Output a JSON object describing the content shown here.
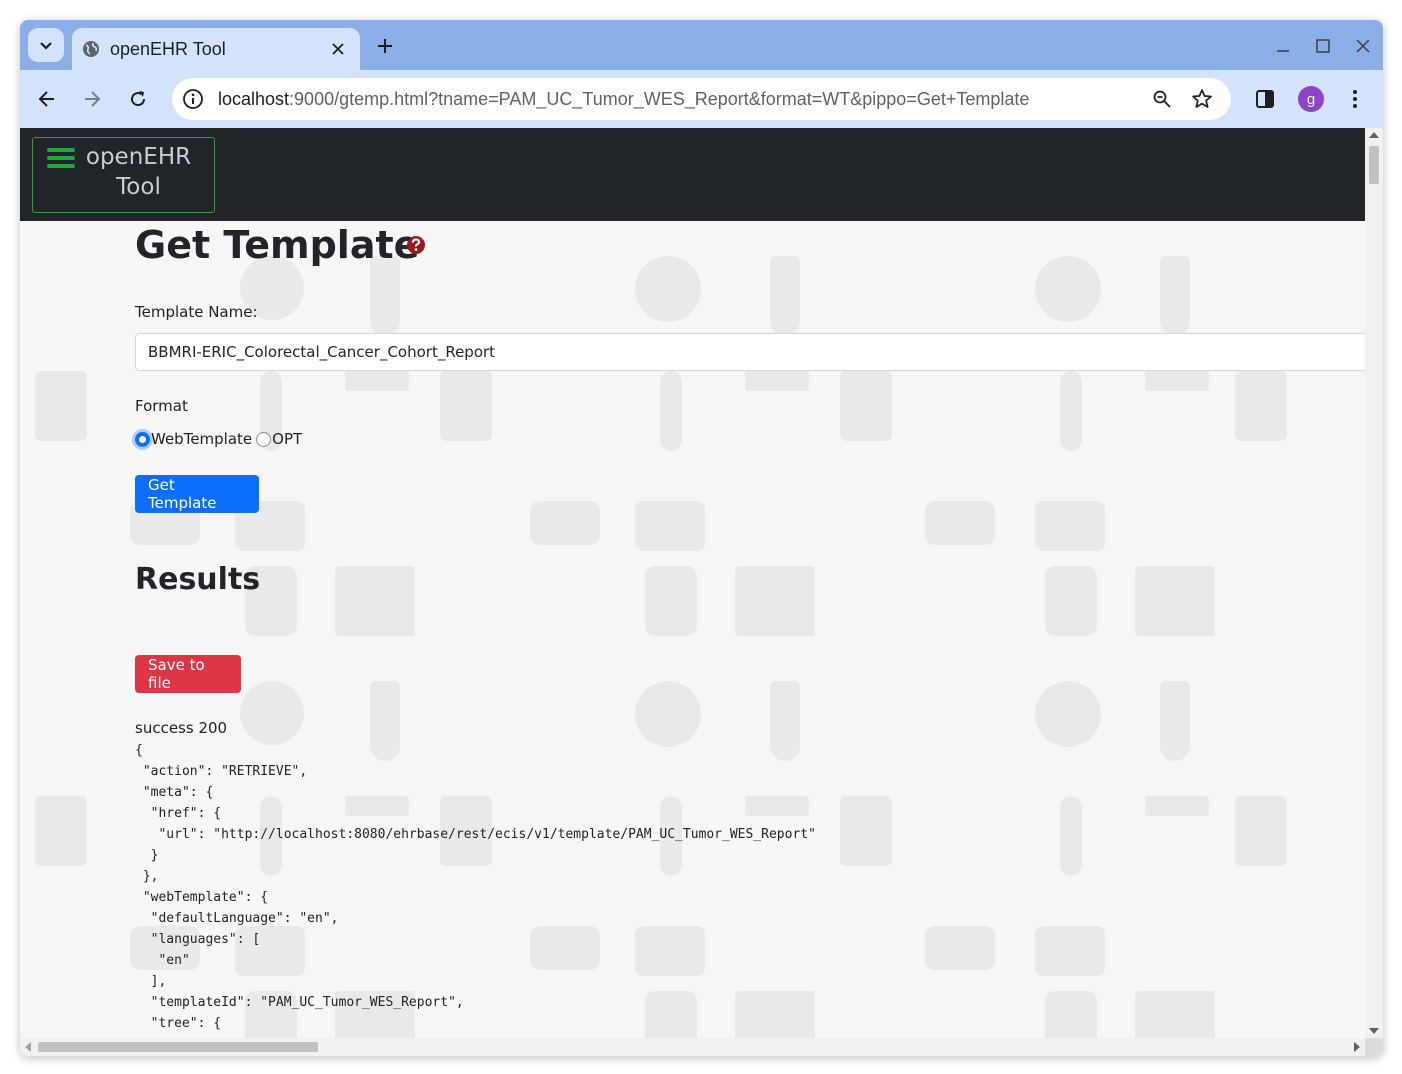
{
  "browser": {
    "tab_title": "openEHR Tool",
    "url_host": "localhost",
    "url_rest": ":9000/gtemp.html?tname=PAM_UC_Tumor_WES_Report&format=WT&pippo=Get+Template",
    "profile_initial": "g",
    "icons": {
      "tab_search": "chevron-down-icon",
      "favicon": "globe-icon",
      "tab_close": "close-icon",
      "new_tab": "plus-icon",
      "minimize": "minimize-icon",
      "maximize": "maximize-icon",
      "close_window": "close-icon",
      "back": "back-arrow-icon",
      "forward": "forward-arrow-icon",
      "reload": "reload-icon",
      "site_info": "info-icon",
      "zoom": "zoom-icon",
      "bookmark": "star-icon",
      "side_panel": "side-panel-icon",
      "menu": "kebab-menu-icon"
    }
  },
  "navbar": {
    "brand_line1": "openEHR",
    "brand_line2": "Tool",
    "toggle_icon": "hamburger-icon"
  },
  "page": {
    "title": "Get Template",
    "help_icon": "help-question-icon",
    "template_name_label": "Template Name:",
    "template_name_value": "BBMRI-ERIC_Colorectal_Cancer_Cohort_Report",
    "format_label": "Format",
    "format_options": [
      {
        "label": "WebTemplate",
        "checked": true
      },
      {
        "label": "OPT",
        "checked": false
      }
    ],
    "submit_label": "Get Template",
    "results_title": "Results",
    "save_label": "Save to file",
    "status": "success 200",
    "json_output": "{\n \"action\": \"RETRIEVE\",\n \"meta\": {\n  \"href\": {\n   \"url\": \"http://localhost:8080/ehrbase/rest/ecis/v1/template/PAM_UC_Tumor_WES_Report\"\n  }\n },\n \"webTemplate\": {\n  \"defaultLanguage\": \"en\",\n  \"languages\": [\n   \"en\"\n  ],\n  \"templateId\": \"PAM_UC_Tumor_WES_Report\",\n  \"tree\": {"
  },
  "colors": {
    "navbar_bg": "#212529",
    "brand_border": "#2ea043",
    "primary": "#0d6efd",
    "danger": "#dc3545",
    "browser_frame": "#8baee6",
    "browser_toolbar": "#d3e3fd"
  }
}
